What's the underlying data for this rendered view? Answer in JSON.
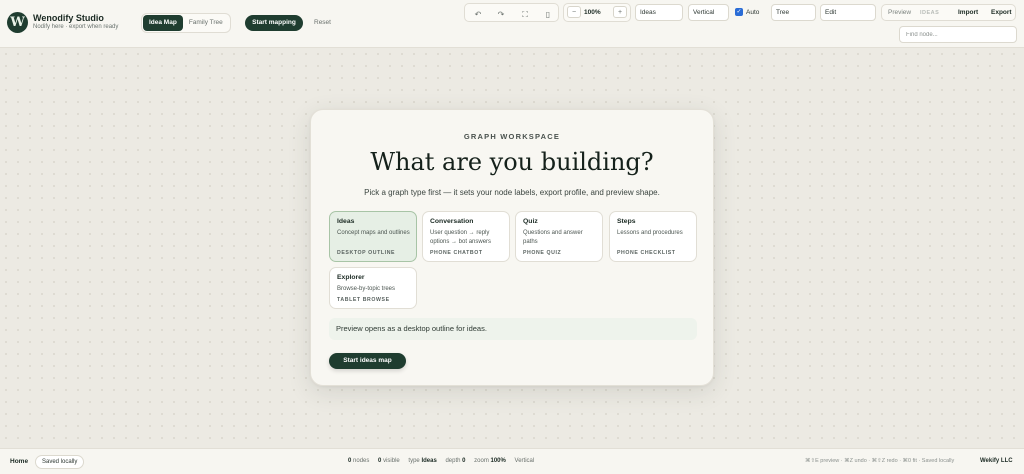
{
  "app": {
    "logo_letter": "W",
    "title": "Wenodify Studio",
    "subtitle": "Nodify here · export when ready"
  },
  "mode_tabs": [
    {
      "label": "Idea Map",
      "active": true
    },
    {
      "label": "Family Tree",
      "active": false
    }
  ],
  "actions": {
    "start_mapping": "Start mapping",
    "reset": "Reset"
  },
  "toolbar": {
    "undo_icon": "↶",
    "redo_icon": "↷",
    "fit_icon": "⛶",
    "mobile_icon": "▯",
    "zoom_out_icon": "−",
    "zoom_in_icon": "+",
    "zoom_level": "100%",
    "graph_type_value": "Ideas",
    "orientation_value": "Vertical",
    "auto_checked": true,
    "auto_label": "Auto",
    "layout_value": "Tree",
    "edit_mode_value": "Edit",
    "preview_label": "Preview",
    "preview_badge": "IDEAS",
    "import_label": "Import",
    "export_label": "Export",
    "find_placeholder": "Find node..."
  },
  "card": {
    "eyebrow": "GRAPH WORKSPACE",
    "headline": "What are you building?",
    "subtitle": "Pick a graph type first — it sets your node labels, export profile, and preview shape.",
    "options": [
      {
        "title": "Ideas",
        "desc": "Concept maps and outlines",
        "tag": "DESKTOP OUTLINE",
        "selected": true
      },
      {
        "title": "Conversation",
        "desc": "User question → reply options → bot answers",
        "tag": "PHONE CHATBOT",
        "selected": false
      },
      {
        "title": "Quiz",
        "desc": "Questions and answer paths",
        "tag": "PHONE QUIZ",
        "selected": false
      },
      {
        "title": "Steps",
        "desc": "Lessons and procedures",
        "tag": "PHONE CHECKLIST",
        "selected": false
      },
      {
        "title": "Explorer",
        "desc": "Browse-by-topic trees",
        "tag": "TABLET BROWSE",
        "selected": false
      }
    ],
    "preview_note": "Preview opens as a desktop outline for ideas.",
    "start_button": "Start ideas map"
  },
  "status": {
    "home": "Home",
    "saved": "Saved locally",
    "nodes_value": "0",
    "nodes_label": "nodes",
    "visible_value": "0",
    "visible_label": "visible",
    "type_label": "type",
    "type_value": "Ideas",
    "depth_label": "depth",
    "depth_value": "0",
    "zoom_label": "zoom",
    "zoom_value": "100%",
    "orientation": "Vertical",
    "hints": "⌘⇧E preview · ⌘Z undo · ⌘⇧Z redo · ⌘0 fit · Saved locally",
    "brand": "Wekify LLC"
  },
  "colors": {
    "accent": "#1f3d30",
    "selected_card": "#e6efe5",
    "background": "#eceae3",
    "checkbox": "#2a6cd6"
  }
}
